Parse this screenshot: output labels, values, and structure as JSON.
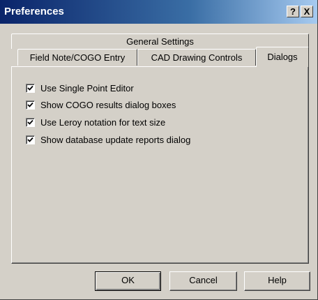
{
  "window": {
    "title": "Preferences",
    "help_button": "?",
    "close_button": "X"
  },
  "tabs": {
    "row1": [
      "General Settings"
    ],
    "row2": [
      "Field Note/COGO Entry",
      "CAD Drawing Controls",
      "Dialogs"
    ],
    "active": "Dialogs"
  },
  "options": [
    {
      "label": "Use Single Point Editor",
      "checked": true
    },
    {
      "label": "Show COGO results dialog boxes",
      "checked": true
    },
    {
      "label": "Use Leroy notation for text size",
      "checked": true
    },
    {
      "label": "Show database update reports dialog",
      "checked": true
    }
  ],
  "buttons": {
    "ok": "OK",
    "cancel": "Cancel",
    "help": "Help"
  }
}
